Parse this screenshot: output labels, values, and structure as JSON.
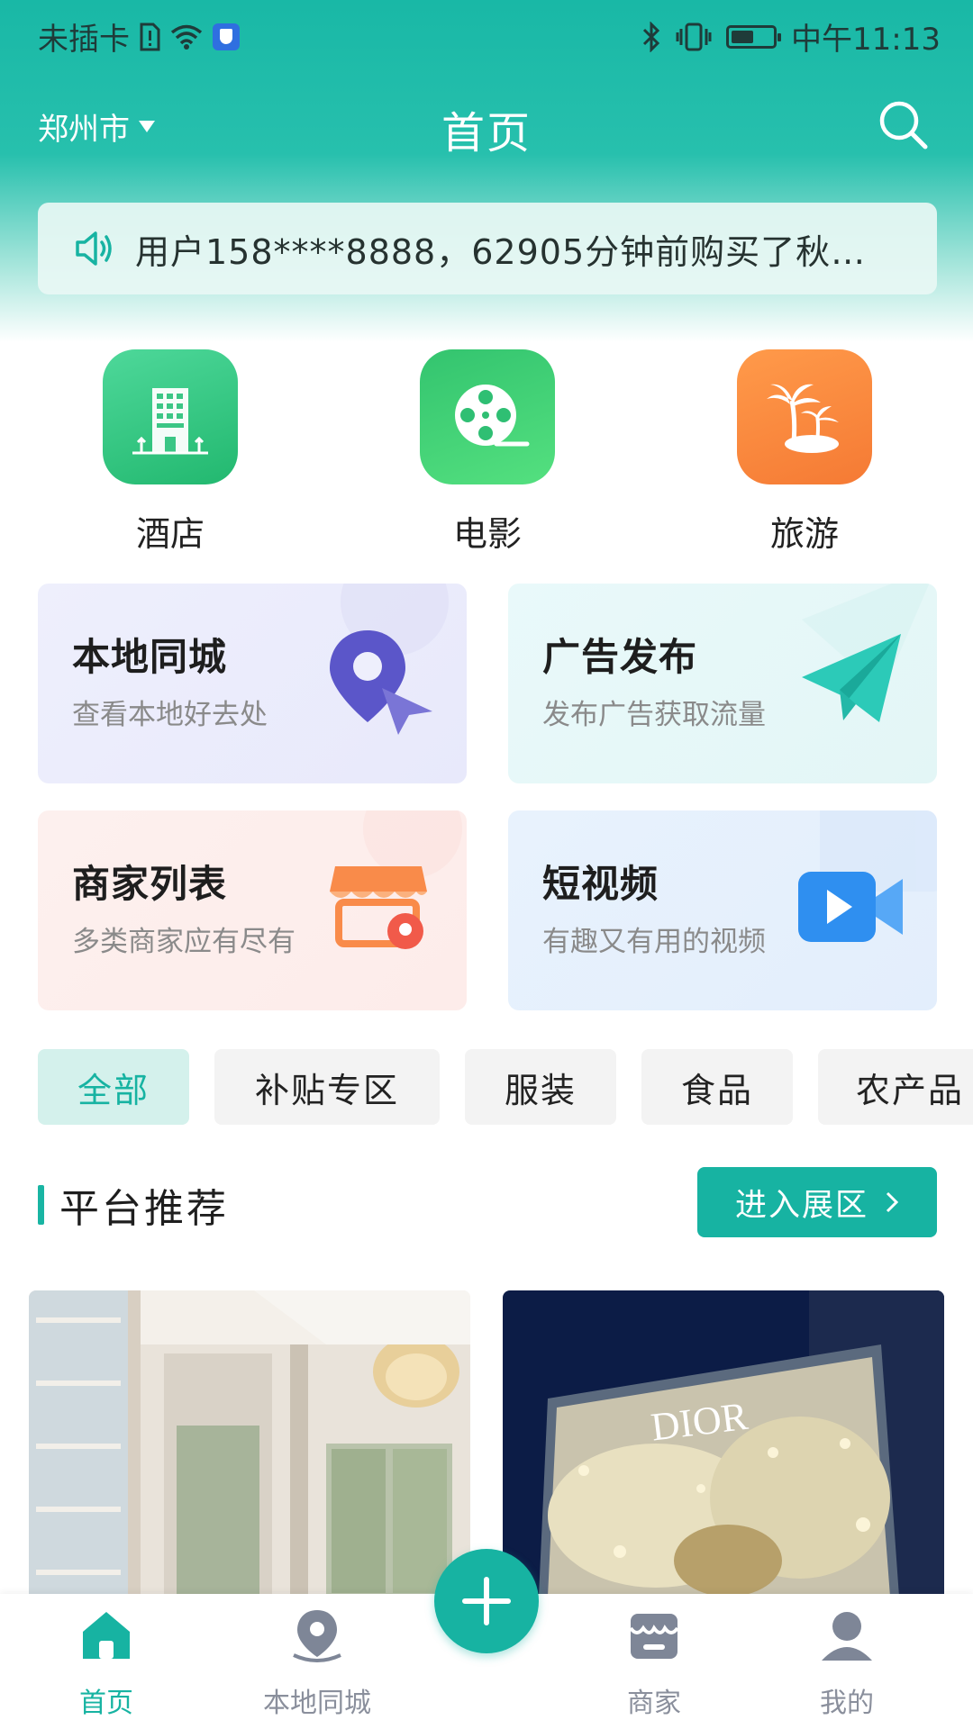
{
  "status_bar": {
    "carrier": "未插卡",
    "time": "中午11:13",
    "battery_level": 0.55
  },
  "header": {
    "city": "郑州市",
    "title": "首页"
  },
  "notice": {
    "text": "用户158****8888，62905分钟前购买了秋…"
  },
  "categories": [
    {
      "label": "酒店",
      "icon": "hotel-icon",
      "color": "#2ec27e"
    },
    {
      "label": "电影",
      "icon": "film-reel-icon",
      "color": "#2ec27e"
    },
    {
      "label": "旅游",
      "icon": "palm-island-icon",
      "color": "#f7843a"
    }
  ],
  "feature_cards": [
    {
      "title": "本地同城",
      "subtitle": "查看本地好去处",
      "icon": "location-pin-icon",
      "bg": "#eceefc"
    },
    {
      "title": "广告发布",
      "subtitle": "发布广告获取流量",
      "icon": "paper-plane-icon",
      "bg": "#e8f8f8"
    },
    {
      "title": "商家列表",
      "subtitle": "多类商家应有尽有",
      "icon": "store-icon",
      "bg": "#fdeeec"
    },
    {
      "title": "短视频",
      "subtitle": "有趣又有用的视频",
      "icon": "video-camera-icon",
      "bg": "#e6f1fd"
    }
  ],
  "chips": [
    {
      "label": "全部",
      "active": true
    },
    {
      "label": "补贴专区",
      "active": false
    },
    {
      "label": "服装",
      "active": false
    },
    {
      "label": "食品",
      "active": false
    },
    {
      "label": "农产品",
      "active": false
    }
  ],
  "section": {
    "title": "平台推荐",
    "enter_label": "进入展区"
  },
  "products": [
    {
      "image": "luxury-interior-photo"
    },
    {
      "image": "dior-storefront-photo",
      "sign_text": "DIOR"
    }
  ],
  "bottom_nav": [
    {
      "label": "首页",
      "icon": "home-icon",
      "active": true
    },
    {
      "label": "本地同城",
      "icon": "location-pin-icon",
      "active": false
    },
    {
      "label": "商家",
      "icon": "store-icon",
      "active": false
    },
    {
      "label": "我的",
      "icon": "user-icon",
      "active": false
    }
  ],
  "colors": {
    "primary": "#17b3a2",
    "inactive_nav": "#8a8f9c"
  }
}
